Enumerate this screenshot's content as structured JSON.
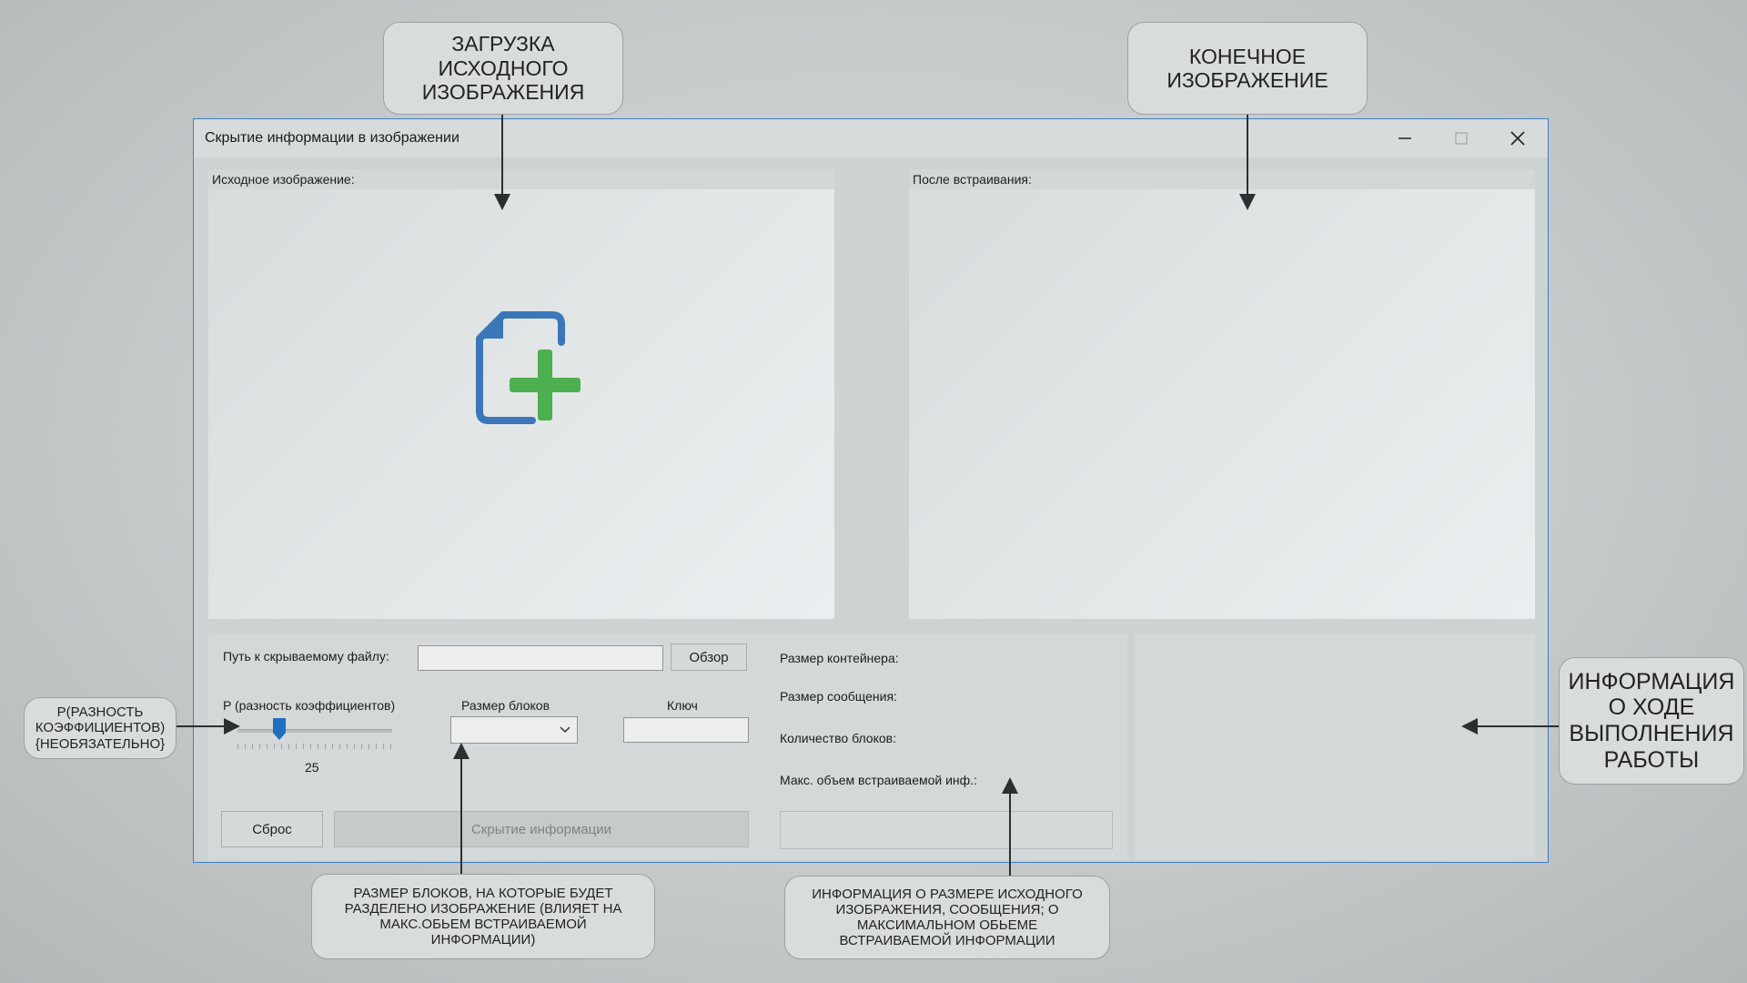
{
  "window": {
    "title": "Скрытие информации в изображении"
  },
  "left_panel": {
    "header": "Исходное изображение:"
  },
  "right_panel": {
    "header": "После встраивания:"
  },
  "controls": {
    "path_label": "Путь к скрываемому файлу:",
    "path_value": "",
    "browse_label": "Обзор",
    "p_label": "P (разность коэффициентов)",
    "slider_value": "25",
    "slider_min": 0,
    "slider_max": 100,
    "slider_level": 25,
    "block_size_label": "Размер блоков",
    "block_size_value": "",
    "key_label": "Ключ",
    "key_value": "",
    "reset_label": "Сброс",
    "hide_label": "Скрытие информации"
  },
  "info": {
    "container_size": "Размер контейнера:",
    "message_size": "Размер сообщения:",
    "block_count": "Количество блоков:",
    "max_volume": "Макс. объем встраиваемой инф.:"
  },
  "callouts": {
    "load_source": [
      "ЗАГРУЗКА",
      "ИСХОДНОГО",
      "ИЗОБРАЖЕНИЯ"
    ],
    "final_image": [
      "КОНЕЧНОЕ",
      "ИЗОБРАЖЕНИЕ"
    ],
    "p_param": [
      "P(РАЗНОСТЬ",
      "КОЭФФИЦИЕНТОВ)",
      "{НЕОБЯЗАТЕЛЬНО}"
    ],
    "progress_info": [
      "ИНФОРМАЦИЯ",
      "О ХОДЕ",
      "ВЫПОЛНЕНИЯ",
      "РАБОТЫ"
    ],
    "block_size": [
      "РАЗМЕР БЛОКОВ, НА КОТОРЫЕ БУДЕТ",
      "РАЗДЕЛЕНО ИЗОБРАЖЕНИЕ (ВЛИЯЕТ НА",
      "МАКС.ОБЬЕМ ВСТРАИВАЕМОЙ",
      "ИНФОРМАЦИИ)"
    ],
    "size_info": [
      "ИНФОРМАЦИЯ О РАЗМЕРЕ ИСХОДНОГО",
      "ИЗОБРАЖЕНИЯ, СООБЩЕНИЯ; О",
      "МАКСИМАЛЬНОМ ОБЬЕМЕ",
      "ВСТРАИВАЕМОЙ ИНФОРМАЦИИ"
    ]
  },
  "colors": {
    "accent": "#3a7fc7",
    "add_icon_doc": "#3b77b8",
    "add_icon_plus": "#4caf50"
  },
  "icons": {
    "add_image": "add-file-icon",
    "minimize": "minimize-icon",
    "maximize": "maximize-icon",
    "close": "close-icon",
    "dropdown": "chevron-down-icon"
  }
}
